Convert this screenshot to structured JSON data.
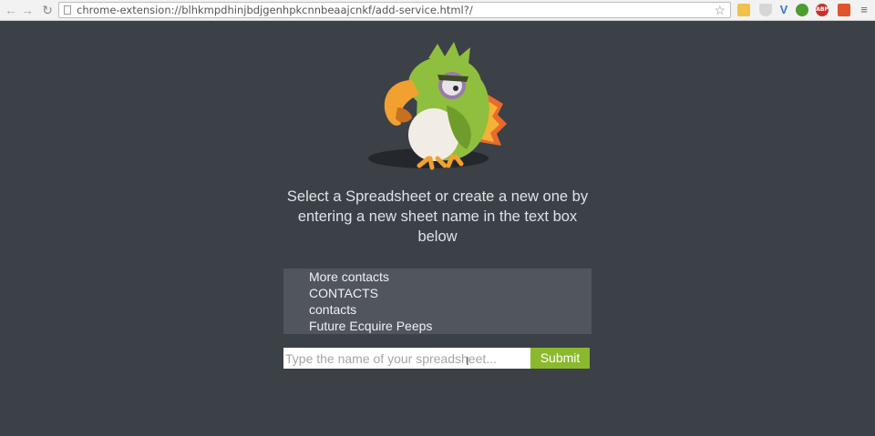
{
  "browser": {
    "url": "chrome-extension://blhkmpdhinjbdjgenhpkcnnbeaajcnkf/add-service.html?/",
    "extensions": [
      {
        "name": "folder-extension-icon"
      },
      {
        "name": "shield-extension-icon"
      },
      {
        "name": "v-extension-icon"
      },
      {
        "name": "bug-extension-icon"
      },
      {
        "name": "adblock-extension-icon",
        "label": "ABP"
      },
      {
        "name": "orange-extension-icon"
      }
    ]
  },
  "page": {
    "instructions": "Select a Spreadsheet or create a new one by entering a new sheet name in the text box below",
    "spreadsheets": [
      "More contacts",
      "CONTACTS",
      "contacts",
      "Future Ecquire Peeps"
    ],
    "input": {
      "placeholder": "Type the name of your spreadsheet...",
      "value": ""
    },
    "submit_label": "Submit"
  },
  "colors": {
    "page_background": "#3c4047",
    "list_background": "#50555e",
    "submit_green": "#8ab92d",
    "parrot_green": "#8fbf3f",
    "beak_orange": "#f2a030"
  }
}
